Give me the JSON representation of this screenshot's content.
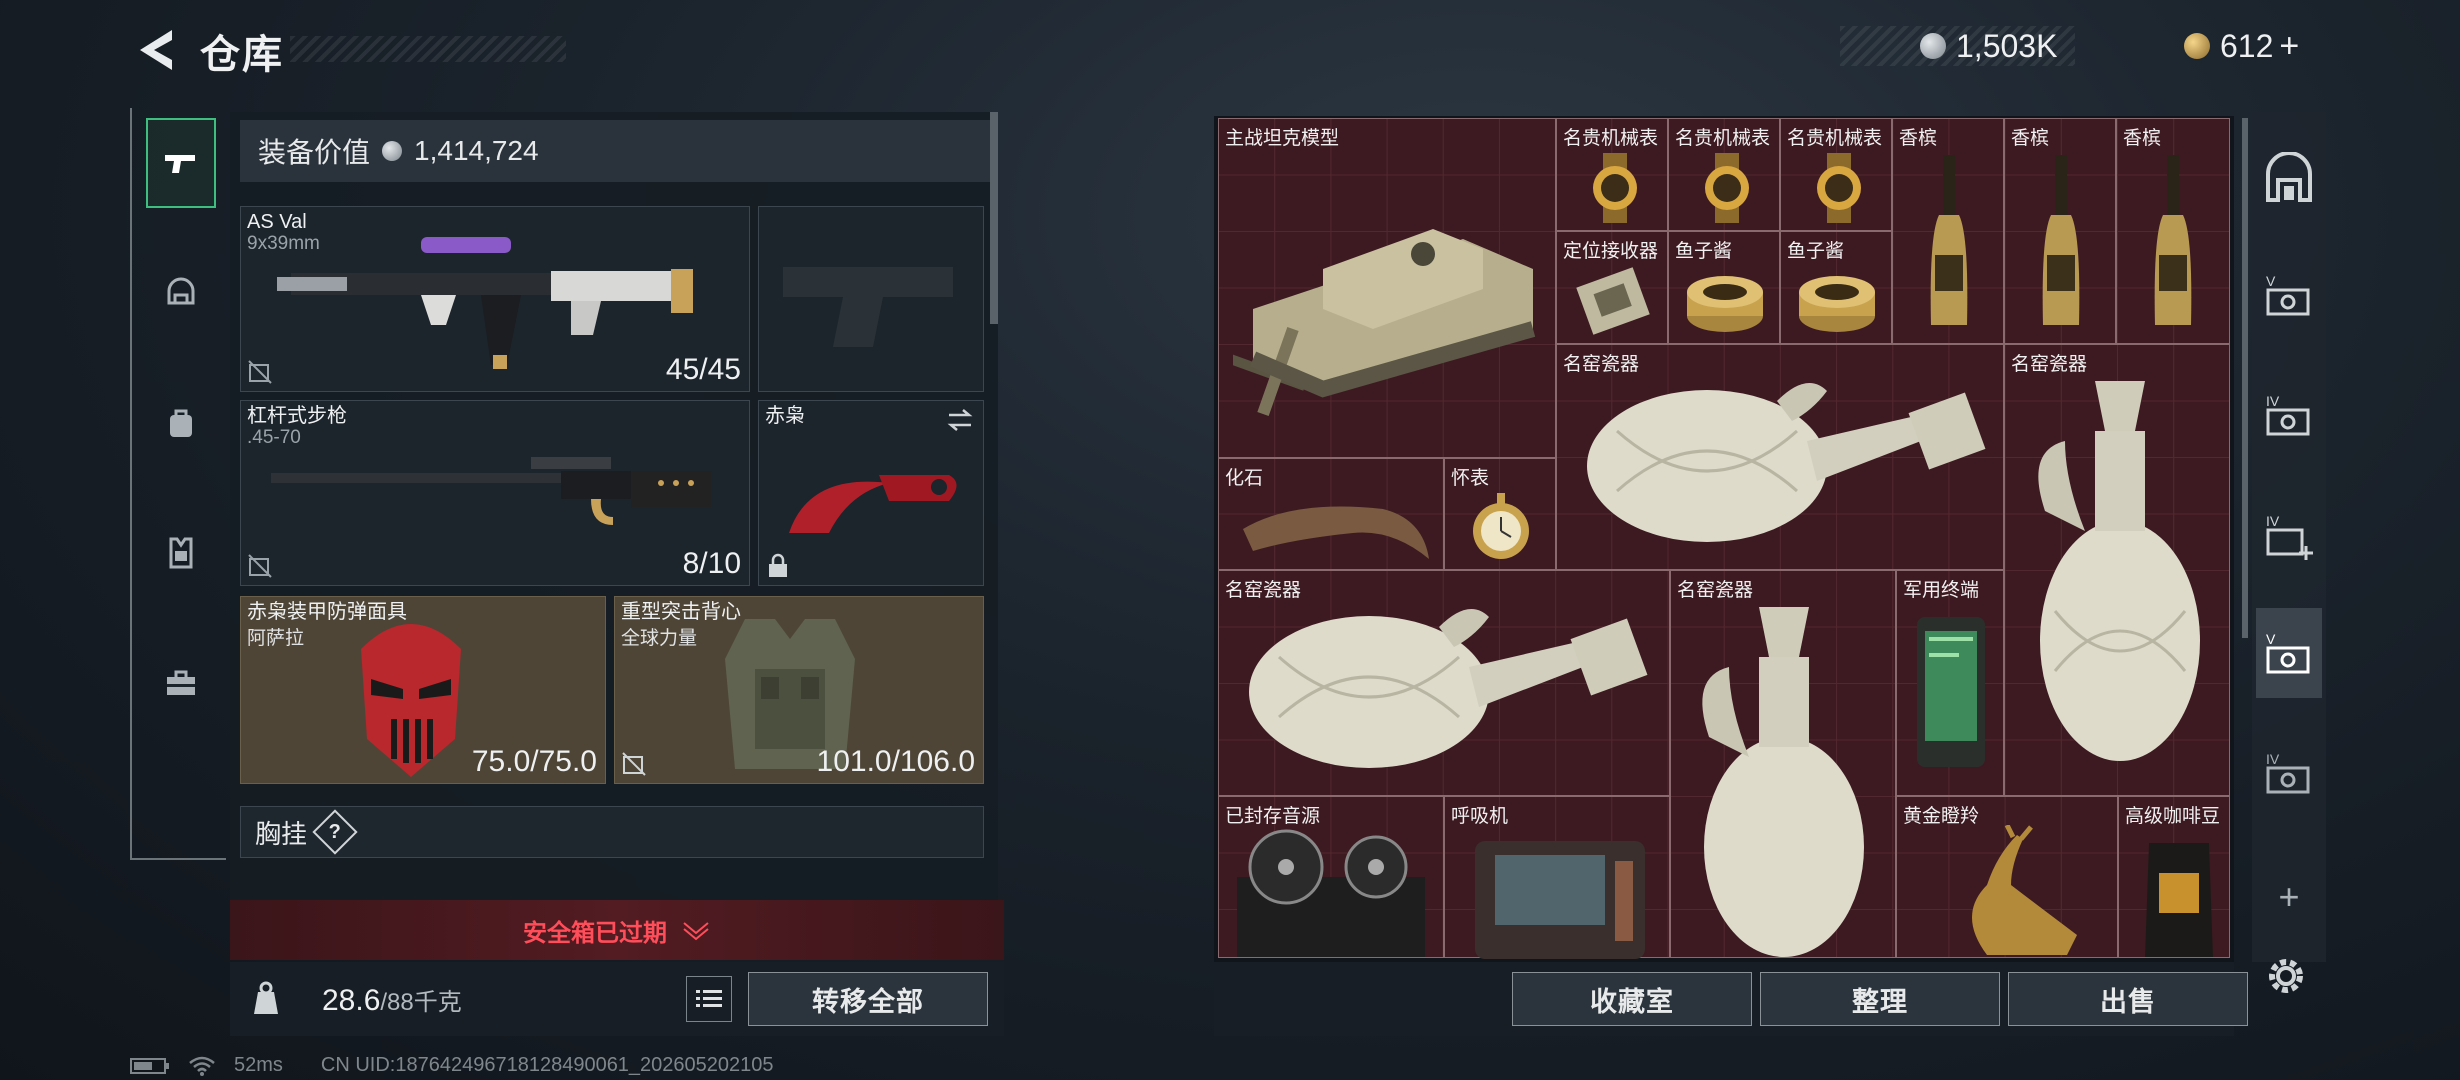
{
  "header": {
    "title": "仓库",
    "currency": [
      {
        "icon": "silver-coin-icon",
        "value": "1,503K"
      },
      {
        "icon": "gold-coin-icon",
        "value": "612",
        "suffix": "+"
      }
    ]
  },
  "left_nav": [
    {
      "name": "weapon-tab",
      "icon": "pistol-icon",
      "active": true
    },
    {
      "name": "helmet-tab",
      "icon": "helmet-icon"
    },
    {
      "name": "backpack-tab",
      "icon": "backpack-icon"
    },
    {
      "name": "vest-tab",
      "icon": "vest-icon"
    },
    {
      "name": "toolbox-tab",
      "icon": "toolbox-icon"
    }
  ],
  "equipment": {
    "value_label": "装备价值",
    "value": "1,414,724",
    "primary": {
      "name": "AS Val",
      "caliber": "9x39mm",
      "ammo": "45/45"
    },
    "secondary_empty_icon": "pistol-silhouette-icon",
    "rifle": {
      "name": "杠杆式步枪",
      "caliber": ".45-70",
      "ammo": "8/10"
    },
    "melee": {
      "name": "赤枭",
      "icon": "karambit-icon"
    },
    "helmet": {
      "name": "赤枭装甲防弹面具",
      "sub": "阿萨拉",
      "durability": "75.0/75.0"
    },
    "armor": {
      "name": "重型突击背心",
      "sub": "全球力量",
      "durability": "101.0/106.0"
    },
    "chest_rig_label": "胸挂",
    "help_mark": "?"
  },
  "safe_box": {
    "text": "安全箱已过期",
    "color": "#ff4d5a"
  },
  "footer_left": {
    "weight": "28.6",
    "capacity": "/88千克",
    "transfer_label": "转移全部"
  },
  "storage_items": [
    {
      "label": "主战坦克模型",
      "icon": "tank-model-icon"
    },
    {
      "label": "名贵机械表",
      "icon": "gold-watch-icon"
    },
    {
      "label": "名贵机械表",
      "icon": "gold-watch-icon"
    },
    {
      "label": "名贵机械表",
      "icon": "gold-watch-icon"
    },
    {
      "label": "香槟",
      "icon": "champagne-icon"
    },
    {
      "label": "香槟",
      "icon": "champagne-icon"
    },
    {
      "label": "香槟",
      "icon": "champagne-icon"
    },
    {
      "label": "定位接收器",
      "icon": "receiver-icon"
    },
    {
      "label": "鱼子酱",
      "icon": "caviar-icon"
    },
    {
      "label": "鱼子酱",
      "icon": "caviar-icon"
    },
    {
      "label": "名窑瓷器",
      "icon": "porcelain-ewer-icon"
    },
    {
      "label": "名窑瓷器",
      "icon": "porcelain-ewer-icon"
    },
    {
      "label": "化石",
      "icon": "fossil-claw-icon"
    },
    {
      "label": "怀表",
      "icon": "pocket-watch-icon"
    },
    {
      "label": "名窑瓷器",
      "icon": "porcelain-ewer-icon"
    },
    {
      "label": "名窑瓷器",
      "icon": "porcelain-ewer-icon"
    },
    {
      "label": "军用终端",
      "icon": "military-terminal-icon"
    },
    {
      "label": "已封存音源",
      "icon": "reel-tape-icon"
    },
    {
      "label": "呼吸机",
      "icon": "ventilator-icon"
    },
    {
      "label": "黄金瞪羚",
      "icon": "gold-gazelle-icon"
    },
    {
      "label": "高级咖啡豆",
      "icon": "coffee-bag-icon"
    }
  ],
  "right_tools": [
    {
      "icon": "archive-icon"
    },
    {
      "icon": "storage-v-icon"
    },
    {
      "icon": "storage-iv-icon"
    },
    {
      "icon": "storage-iv-add-icon"
    },
    {
      "icon": "storage-v-key-icon",
      "active": true
    },
    {
      "icon": "storage-iv-lock-icon"
    },
    {
      "icon": "add-icon",
      "label": "+"
    }
  ],
  "footer_right": {
    "buttons": [
      "收藏室",
      "整理",
      "出售"
    ]
  },
  "status": {
    "ping": "52ms",
    "uid": "CN UID:1876424967181284900​61_202605202105"
  }
}
